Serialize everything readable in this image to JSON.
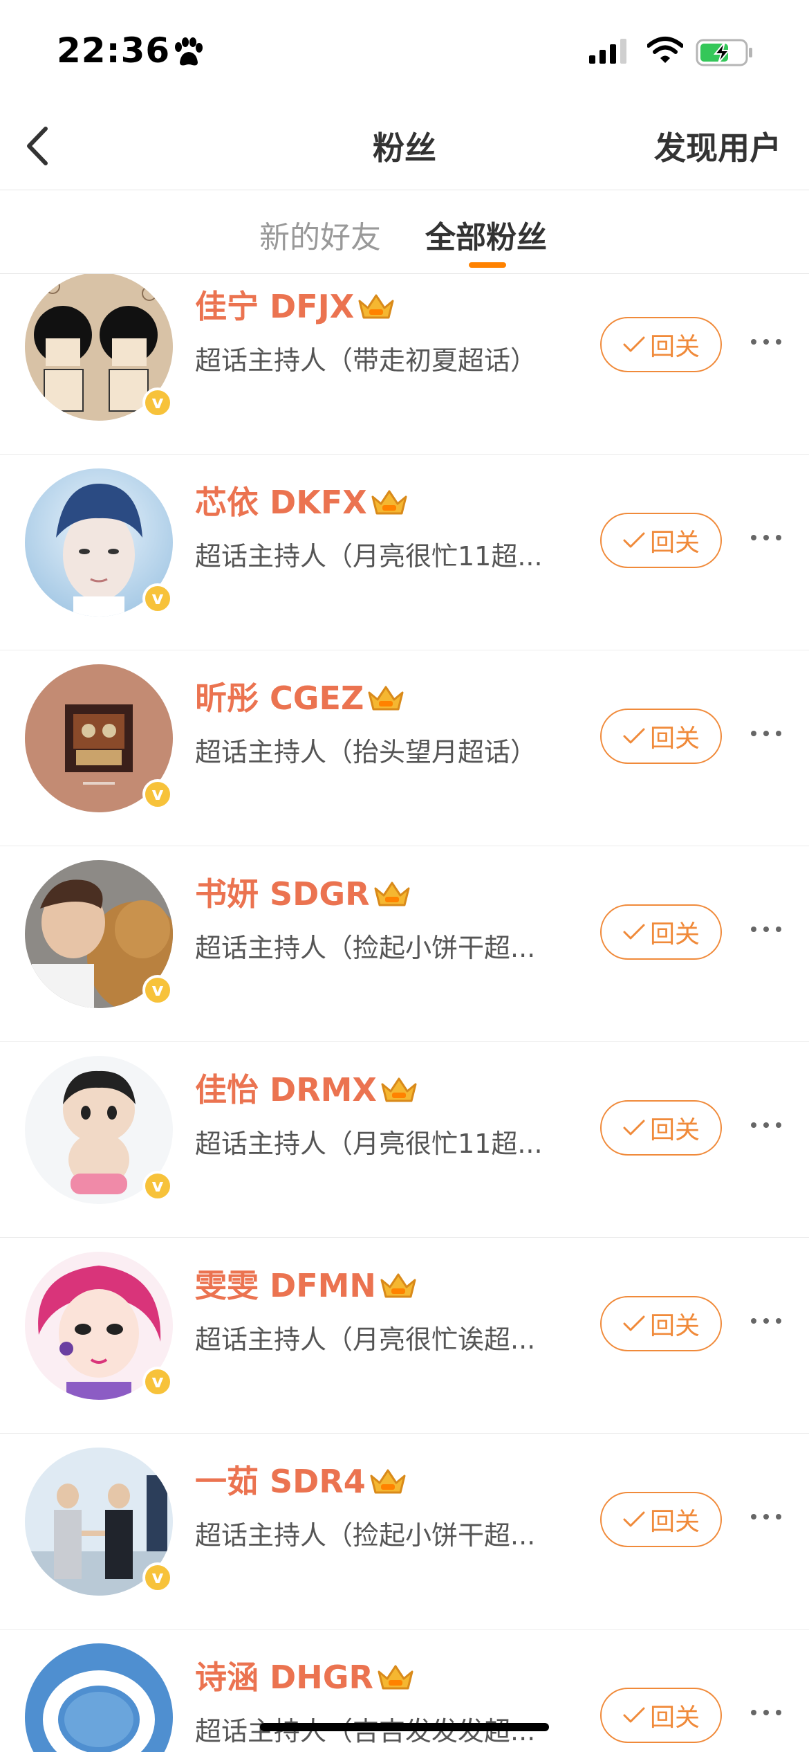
{
  "status_bar": {
    "time": "22:36"
  },
  "nav": {
    "title": "粉丝",
    "right_action": "发现用户"
  },
  "tabs": [
    {
      "label": "新的好友",
      "active": false
    },
    {
      "label": "全部粉丝",
      "active": true
    }
  ],
  "fans": [
    {
      "name": "佳宁 DFJX",
      "desc": "超话主持人（带走初夏超话）",
      "follow_label": "回关",
      "avatar": "cartoon-girls-avatar"
    },
    {
      "name": "芯依 DKFX",
      "desc": "超话主持人（月亮很忙11超...",
      "follow_label": "回关",
      "avatar": "boy-portrait-avatar"
    },
    {
      "name": "昕彤 CGEZ",
      "desc": "超话主持人（抬头望月超话）",
      "follow_label": "回关",
      "avatar": "robot-photo-avatar"
    },
    {
      "name": "书妍 SDGR",
      "desc": "超话主持人（捡起小饼干超...",
      "follow_label": "回关",
      "avatar": "person-with-dog-avatar"
    },
    {
      "name": "佳怡 DRMX",
      "desc": "超话主持人（月亮很忙11超...",
      "follow_label": "回关",
      "avatar": "crayon-figure-avatar"
    },
    {
      "name": "雯雯 DFMN",
      "desc": "超话主持人（月亮很忙诶超...",
      "follow_label": "回关",
      "avatar": "anime-girl-avatar"
    },
    {
      "name": "一茹 SDR4",
      "desc": "超话主持人（捡起小饼干超...",
      "follow_label": "回关",
      "avatar": "businessmen-avatar"
    },
    {
      "name": "诗涵 DHGR",
      "desc": "超话主持人（吉吉发发发超...",
      "follow_label": "回关",
      "avatar": "cloud-sky-avatar"
    }
  ],
  "colors": {
    "accent": "#ff8200",
    "name": "#eb7350",
    "follow": "#f08a3a",
    "badge": "#f7c23a"
  }
}
